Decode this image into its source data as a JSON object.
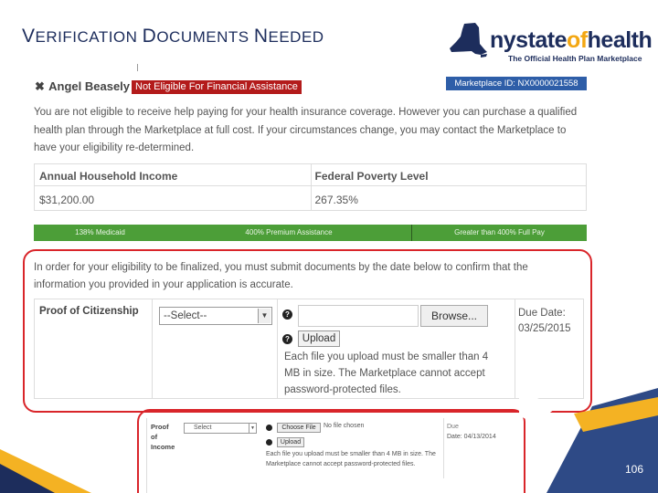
{
  "slide": {
    "title_parts": [
      {
        "big": "V",
        "small": "ERIFICATION "
      },
      {
        "big": "D",
        "small": "OCUMENTS "
      },
      {
        "big": "N",
        "small": "EEDED"
      }
    ],
    "page_number": "106"
  },
  "logo": {
    "name_prefix": "nystate",
    "name_of": "of",
    "name_suffix": "health",
    "tagline": "The Official Health Plan Marketplace"
  },
  "header": {
    "close_icon": "✖",
    "person_name": "Angel Beasely",
    "status_badge": "Not Eligible For Financial Assistance",
    "marketplace_id": "Marketplace ID: NX0000021558",
    "colors": {
      "status_badge": "#b31b1b",
      "marketplace_badge": "#2e5ea8"
    }
  },
  "eligibility_message": "You are not eligible to receive help paying for your health insurance coverage. However you can purchase a qualified health plan through the Marketplace at full cost. If your circumstances change, you may contact the Marketplace to have your eligibility re-determined.",
  "income_table": {
    "headers": [
      "Annual Household Income",
      "Federal Poverty Level"
    ],
    "values": [
      "$31,200.00",
      "267.35%"
    ]
  },
  "fpl_bar": {
    "segments": [
      "138% Medicaid",
      "400% Premium Assistance",
      "Greater than 400% Full Pay"
    ],
    "color": "#4c9e38"
  },
  "documents": {
    "instructions": "In order for your eligibility to be finalized, you must submit documents by the date below to confirm that the information you provided in your application is accurate.",
    "row": {
      "label": "Proof of Citizenship",
      "select_value": "--Select--",
      "browse_label": "Browse...",
      "upload_label": "Upload",
      "help_icon": "?",
      "file_note": "Each file you upload must be smaller than 4 MB in size. The Marketplace cannot accept password-protected files.",
      "due_label": "Due Date:",
      "due_date": "03/25/2015"
    }
  },
  "second_row": {
    "label_lines": [
      "Proof",
      "of",
      "Income"
    ],
    "select_value": "Select",
    "choose_label": "Choose File",
    "no_file": "No file chosen",
    "upload_label": "Upload",
    "file_note": "Each file you upload must be smaller than 4 MB in size. The Marketplace cannot accept password-protected files.",
    "due_label": "Due",
    "due_date": "Date: 04/13/2014"
  },
  "highlight_color": "#d9252a"
}
